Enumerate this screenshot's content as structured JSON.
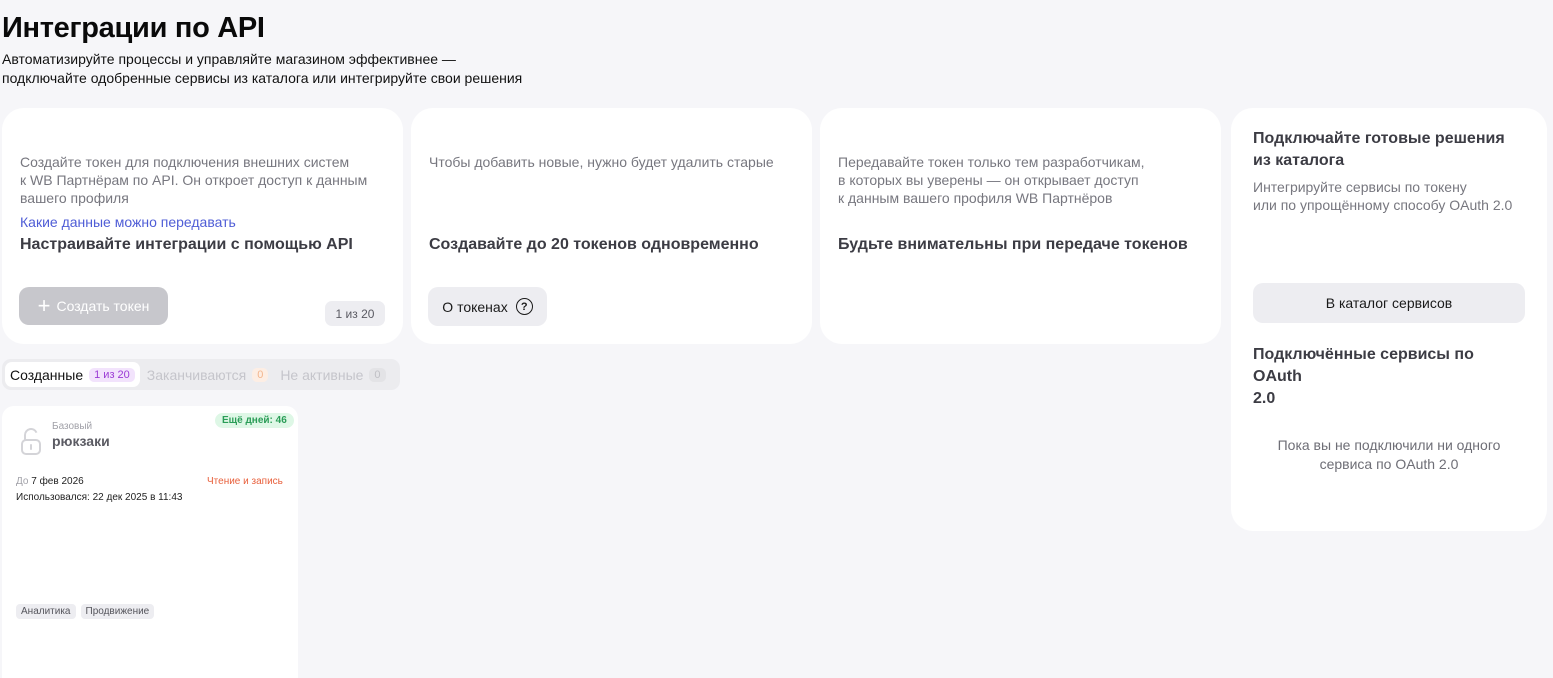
{
  "header": {
    "title": "Интеграции по API",
    "subtitle_line1": "Автоматизируйте процессы и управляйте магазином эффективнее —",
    "subtitle_line2": "подключайте одобренные сервисы из каталога или интегрируйте свои решения"
  },
  "cards": {
    "api": {
      "title": "Настраивайте интеграции с помощью API",
      "text_line1": "Создайте токен для подключения внешних систем",
      "text_line2": "к WB Партнёрам по API. Он откроет доступ к данным",
      "text_line3": "вашего профиля",
      "link": "Какие данные можно передавать",
      "create_button": "Создать токен",
      "counter": "1 из 20"
    },
    "limit": {
      "title": "Создавайте до 20 токенов одновременно",
      "text": "Чтобы добавить новые, нужно будет удалить старые",
      "about_button": "О токенах"
    },
    "careful": {
      "title": "Будьте внимательны при передаче токенов",
      "text_line1": "Передавайте токен только тем разработчикам,",
      "text_line2": "в которых вы уверены — он открывает доступ",
      "text_line3": "к данным вашего профиля WB Партнёров"
    },
    "catalog": {
      "title_line1": "Подключайте готовые решения",
      "title_line2": "из каталога",
      "text_line1": "Интегрируйте сервисы по токену",
      "text_line2": "или по упрощённому способу OAuth 2.0",
      "button": "В каталог сервисов",
      "connected_title_line1": "Подключённые сервисы по OAuth",
      "connected_title_line2": "2.0",
      "empty_line1": "Пока вы не подключили ни одного",
      "empty_line2": "сервиса по OAuth 2.0"
    }
  },
  "tabs": [
    {
      "label": "Созданные",
      "badge": "1 из 20",
      "active": true
    },
    {
      "label": "Заканчиваются",
      "badge": "0",
      "active": false
    },
    {
      "label": "Не активные",
      "badge": "0",
      "active": false
    }
  ],
  "token": {
    "type": "Базовый",
    "name": "рюкзаки",
    "days_left": "Ещё дней: 46",
    "until_prefix": "До",
    "until_date": "7 фев 2026",
    "access": "Чтение и запись",
    "last_used": "Использовался: 22 дек 2025 в 11:43",
    "scopes": [
      "Аналитика",
      "Продвижение"
    ]
  },
  "colors": {
    "background": "#f6f6f9",
    "link": "#4f5dd6",
    "badge_purple": "#9b3ad5",
    "success": "#2a9d57",
    "warning": "#e8603c"
  },
  "icons": {
    "create": "plus-icon",
    "about": "question-circle-icon",
    "token": "lock-open-icon"
  }
}
